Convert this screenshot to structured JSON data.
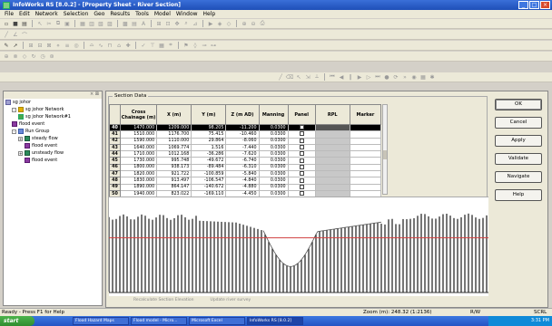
{
  "window": {
    "title": "InfoWorks RS [8.0.2] - [Property Sheet - River Section]"
  },
  "menu": [
    "File",
    "Edit",
    "Network",
    "Selection",
    "Geo",
    "Results",
    "Tools",
    "Model",
    "Window",
    "Help"
  ],
  "tree": {
    "items": [
      {
        "label": "sg johor",
        "icon": "database-icon",
        "indent": 0,
        "toggle": ""
      },
      {
        "label": "sg johor Network",
        "icon": "network-icon",
        "indent": 1,
        "toggle": "-"
      },
      {
        "label": "sg johor Network#1",
        "icon": "network-version-icon",
        "indent": 2,
        "toggle": ""
      },
      {
        "label": "flood event",
        "icon": "flood-event-icon",
        "indent": 1,
        "toggle": ""
      },
      {
        "label": "Run Group",
        "icon": "run-group-icon",
        "indent": 1,
        "toggle": "-"
      },
      {
        "label": "steady flow",
        "icon": "steady-flow-icon",
        "indent": 2,
        "toggle": "+"
      },
      {
        "label": "flood event",
        "icon": "flood-event-icon",
        "indent": 3,
        "toggle": ""
      },
      {
        "label": "unsteady flow",
        "icon": "unsteady-flow-icon",
        "indent": 2,
        "toggle": "+"
      },
      {
        "label": "flood event",
        "icon": "flood-event-icon",
        "indent": 3,
        "toggle": ""
      }
    ]
  },
  "section": {
    "legend": "Section Data",
    "columns": [
      "Cross Chainage (m)",
      "X (m)",
      "Y (m)",
      "Z (m AD)",
      "Manning",
      "Panel",
      "RPL",
      "Marker"
    ],
    "rows": [
      {
        "n": "40",
        "chainage": "1470.000",
        "x": "1209.000",
        "y": "98.205",
        "z": "-11.200",
        "manning": "0.0300",
        "selected": true
      },
      {
        "n": "41",
        "chainage": "1510.000",
        "x": "1176.700",
        "y": "75.415",
        "z": "-10.460",
        "manning": "0.0300"
      },
      {
        "n": "42",
        "chainage": "1590.000",
        "x": "1110.000",
        "y": "29.864",
        "z": "-8.060",
        "manning": "0.0300"
      },
      {
        "n": "43",
        "chainage": "1640.000",
        "x": "1069.774",
        "y": "1.516",
        "z": "-7.440",
        "manning": "0.0300"
      },
      {
        "n": "44",
        "chainage": "1710.000",
        "x": "1012.168",
        "y": "-36.286",
        "z": "-7.620",
        "manning": "0.0300"
      },
      {
        "n": "45",
        "chainage": "1730.000",
        "x": "995.748",
        "y": "-49.672",
        "z": "-6.740",
        "manning": "0.0300"
      },
      {
        "n": "46",
        "chainage": "1800.000",
        "x": "938.173",
        "y": "-89.484",
        "z": "-6.310",
        "manning": "0.0300"
      },
      {
        "n": "47",
        "chainage": "1820.000",
        "x": "921.722",
        "y": "-100.859",
        "z": "-5.840",
        "manning": "0.0300"
      },
      {
        "n": "48",
        "chainage": "1830.000",
        "x": "913.497",
        "y": "-106.547",
        "z": "-4.840",
        "manning": "0.0300"
      },
      {
        "n": "49",
        "chainage": "1890.000",
        "x": "864.147",
        "y": "-140.672",
        "z": "-4.880",
        "manning": "0.0300"
      },
      {
        "n": "50",
        "chainage": "1940.000",
        "x": "823.022",
        "y": "-169.110",
        "z": "-4.450",
        "manning": "0.0300"
      }
    ]
  },
  "buttons": {
    "ok": "OK",
    "cancel": "Cancel",
    "apply": "Apply",
    "validate": "Validate",
    "navigate": "Navigate",
    "help": "Help"
  },
  "dialog_footer": {
    "left": "Recalculate Section Elevation",
    "right": "Update river survey"
  },
  "status": {
    "left": "Ready - Press F1 for Help",
    "zoom": "Zoom (m): 248.32 (1:2136)",
    "rw": "R/W",
    "scr": "SCRL"
  },
  "taskbar": {
    "start": "start",
    "items": [
      "Flood Hazard Maps",
      "Flood model - Micro...",
      "Microsoft Excel",
      "InfoWorks RS [8.0.2]"
    ],
    "clock": "3:31 PM"
  },
  "colors": {
    "title_blue": "#2453c4",
    "profile_bed": "#1a1a1a",
    "water_level": "#d04040"
  }
}
